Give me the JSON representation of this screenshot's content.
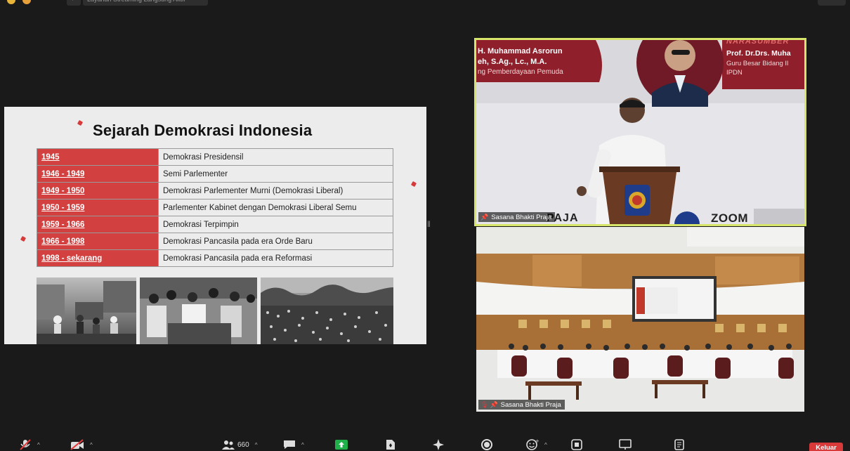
{
  "window": {
    "tab_title": "Layanan Streaming Langsung Aktif"
  },
  "slide": {
    "title": "Sejarah Demokrasi Indonesia",
    "periods": [
      {
        "years": "1945",
        "system": "Demokrasi Presidensil"
      },
      {
        "years": "1946 - 1949",
        "system": "Semi Parlementer"
      },
      {
        "years": "1949 - 1950",
        "system": "Demokrasi Parlementer Murni (Demokrasi Liberal)"
      },
      {
        "years": "1950 - 1959",
        "system": "Parlementer Kabinet dengan Demokrasi Liberal Semu"
      },
      {
        "years": "1959 - 1966",
        "system": "Demokrasi Terpimpin"
      },
      {
        "years": "1966 - 1998",
        "system": "Demokrasi Pancasila pada era Orde Baru"
      },
      {
        "years": "1998 - sekarang",
        "system": "Demokrasi Pancasila pada era Reformasi"
      }
    ],
    "colors": {
      "accent": "#d24140",
      "background": "#ececec"
    }
  },
  "video": {
    "speaker_tile": {
      "participant_name": "Sasana Bhakti Praja",
      "banner_left_line1": "H. Muhammad Asrorun",
      "banner_left_line2": "eh, S.Ag., Lc., M.A.",
      "banner_left_line3": "ng Pemberdayaan Pemuda",
      "banner_right_label": "NARASUMBER",
      "banner_right_name": "Prof. Dr.Drs. Muha",
      "banner_right_line2": "Guru Besar Bidang Il",
      "banner_right_line3": "IPDN",
      "backdrop_text_left": "PAJA",
      "backdrop_text_right": "ZOOM",
      "active_border": "#d7e66a"
    },
    "hall_tile": {
      "participant_name": "Sasana Bhakti Praja"
    }
  },
  "toolbar": {
    "participants_count": "660",
    "leave_label": "Keluar"
  }
}
